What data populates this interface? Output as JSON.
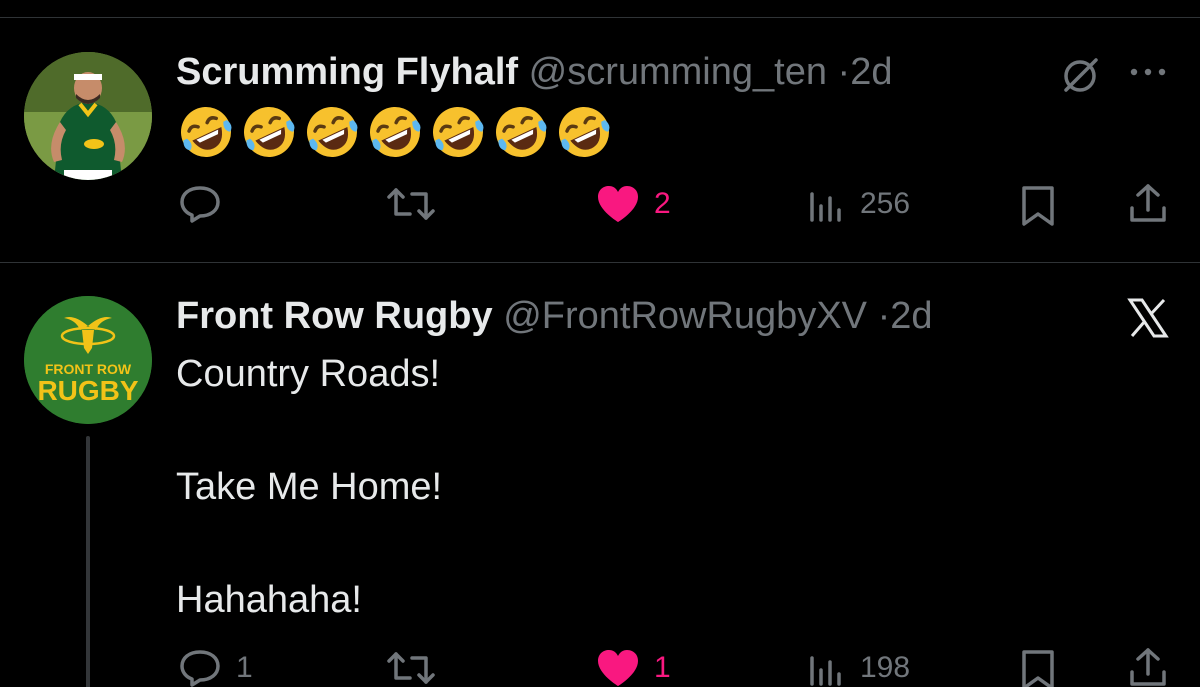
{
  "colors": {
    "background": "#000000",
    "text_primary": "#e7e9ea",
    "text_secondary": "#71767b",
    "like_pink": "#f91880",
    "divider": "#2f3336",
    "rugby_green": "#2f7d2f",
    "rugby_gold": "#f2c318"
  },
  "tweets": [
    {
      "display_name": "Scrumming Flyhalf",
      "handle": "@scrumming_ten",
      "separator": "·",
      "time": "2d",
      "avatar_icon": "rugby-player-avatar",
      "body_emojis": [
        "rolling-on-floor-laughing-emoji",
        "rolling-on-floor-laughing-emoji",
        "rolling-on-floor-laughing-emoji",
        "rolling-on-floor-laughing-emoji",
        "rolling-on-floor-laughing-emoji",
        "rolling-on-floor-laughing-emoji",
        "rolling-on-floor-laughing-emoji"
      ],
      "badge_icon": "grok-icon",
      "more_icon": "more-horizontal-icon",
      "actions": {
        "reply_count": "",
        "retweet_count": "",
        "like_count": "2",
        "liked": true,
        "view_count": "256"
      }
    },
    {
      "display_name": "Front Row Rugby",
      "handle": "@FrontRowRugbyXV",
      "separator": "·",
      "time": "2d",
      "avatar_icon": "front-row-rugby-logo",
      "avatar_text_top": "FRONT ROW",
      "avatar_text_bottom": "RUGBY",
      "badge_icon": "x-logo-icon",
      "body_lines": [
        "Country Roads!",
        "Take Me Home!",
        "Hahahaha!"
      ],
      "actions": {
        "reply_count": "1",
        "retweet_count": "",
        "like_count": "1",
        "liked": true,
        "view_count": "198"
      }
    }
  ]
}
